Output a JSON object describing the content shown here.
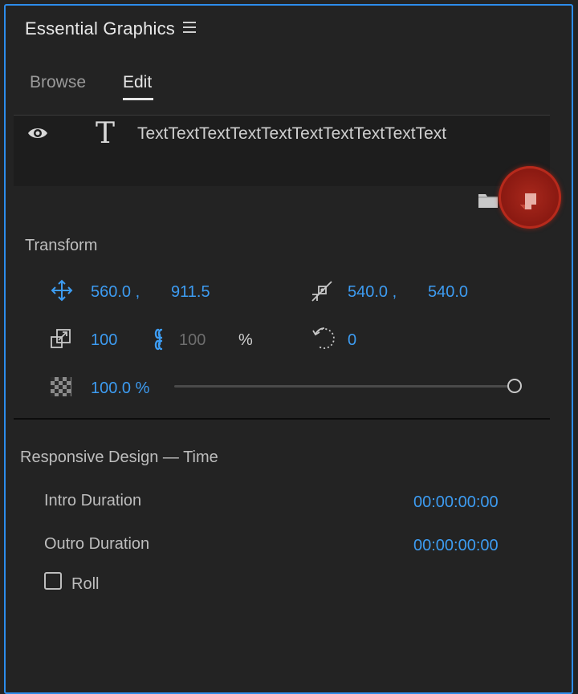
{
  "panel": {
    "title": "Essential Graphics",
    "menu_icon": "hamburger-menu-icon"
  },
  "tabs": [
    {
      "label": "Browse",
      "active": false
    },
    {
      "label": "Edit",
      "active": true
    }
  ],
  "layer": {
    "name": "TextTextTextTextTextTextTextTextTextText",
    "text_glyph": "T",
    "icons": [
      "eye-icon",
      "text-layer-icon"
    ]
  },
  "layer_actions": {
    "folder_icon": "folder-icon",
    "new_layer_icon": "new-layer-icon",
    "new_layer_highlight": "#a8281c"
  },
  "transform": {
    "title": "Transform",
    "position": {
      "x": "560.0 ,",
      "y": "911.5"
    },
    "anchor": {
      "x": "540.0 ,",
      "y": "540.0"
    },
    "scale": {
      "value": "100",
      "height": "100",
      "unit": "%",
      "linked": true
    },
    "rotation": {
      "value": "0"
    },
    "opacity": {
      "value": "100.0 %",
      "level": 1.0
    }
  },
  "responsive_design": {
    "title": "Responsive Design — Time",
    "intro": {
      "label": "Intro Duration",
      "value": "00:00:00:00"
    },
    "outro": {
      "label": "Outro Duration",
      "value": "00:00:00:00"
    },
    "roll": {
      "label": "Roll",
      "checked": false
    }
  },
  "colors": {
    "accent": "#3d9cf2",
    "panel_border": "#2d8ceb",
    "background": "#232323"
  }
}
